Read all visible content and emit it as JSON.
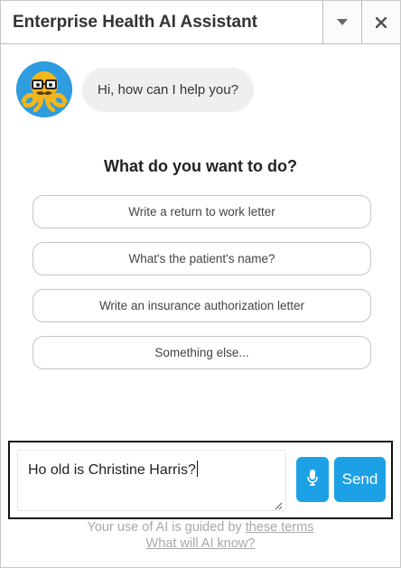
{
  "window": {
    "title": "Enterprise Health AI Assistant",
    "controls": [
      {
        "name": "chevron-down-icon"
      },
      {
        "name": "close-icon"
      }
    ]
  },
  "bot": {
    "avatar_icon": "octopus-avatar-icon",
    "greeting": "Hi, how can I help you?"
  },
  "prompt": {
    "question": "What do you want to do?",
    "options": [
      {
        "label": "Write a return to work letter"
      },
      {
        "label": "What's the patient's name?"
      },
      {
        "label": "Write an insurance authorization letter"
      },
      {
        "label": "Something else..."
      }
    ]
  },
  "composer": {
    "input_value": "Ho old is Christine Harris?",
    "mic_icon": "microphone-icon",
    "send_label": "Send"
  },
  "footer": {
    "terms_prefix": "Your use of AI is guided by ",
    "terms_link": "these terms",
    "knowledge_link": "What will AI know?"
  },
  "colors": {
    "accent": "#1da1e6",
    "bubble": "#efefef",
    "footer_text": "#a8a8a8"
  }
}
